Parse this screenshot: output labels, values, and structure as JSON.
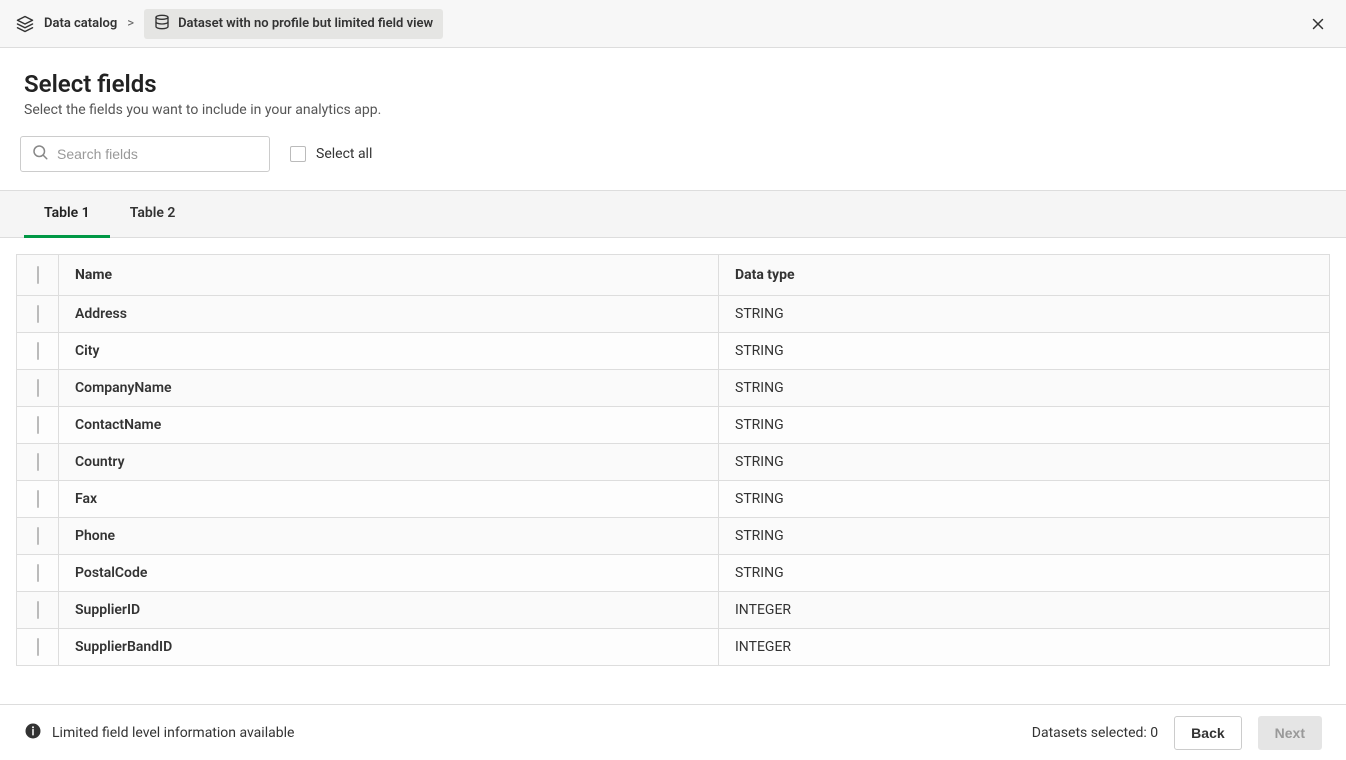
{
  "breadcrumb": {
    "root": "Data catalog",
    "separator": ">",
    "current": "Dataset with no profile but limited field view"
  },
  "title": {
    "heading": "Select fields",
    "subheading": "Select the fields you want to include in your analytics app."
  },
  "controls": {
    "search_placeholder": "Search fields",
    "select_all_label": "Select all"
  },
  "tabs": [
    {
      "label": "Table 1",
      "active": true
    },
    {
      "label": "Table 2",
      "active": false
    }
  ],
  "table": {
    "headers": {
      "name": "Name",
      "type": "Data type"
    },
    "rows": [
      {
        "name": "Address",
        "type": "STRING"
      },
      {
        "name": "City",
        "type": "STRING"
      },
      {
        "name": "CompanyName",
        "type": "STRING"
      },
      {
        "name": "ContactName",
        "type": "STRING"
      },
      {
        "name": "Country",
        "type": "STRING"
      },
      {
        "name": "Fax",
        "type": "STRING"
      },
      {
        "name": "Phone",
        "type": "STRING"
      },
      {
        "name": "PostalCode",
        "type": "STRING"
      },
      {
        "name": "SupplierID",
        "type": "INTEGER"
      },
      {
        "name": "SupplierBandID",
        "type": "INTEGER"
      }
    ]
  },
  "footer": {
    "info": "Limited field level information available",
    "datasets_label": "Datasets selected: ",
    "datasets_count": "0",
    "back": "Back",
    "next": "Next"
  }
}
